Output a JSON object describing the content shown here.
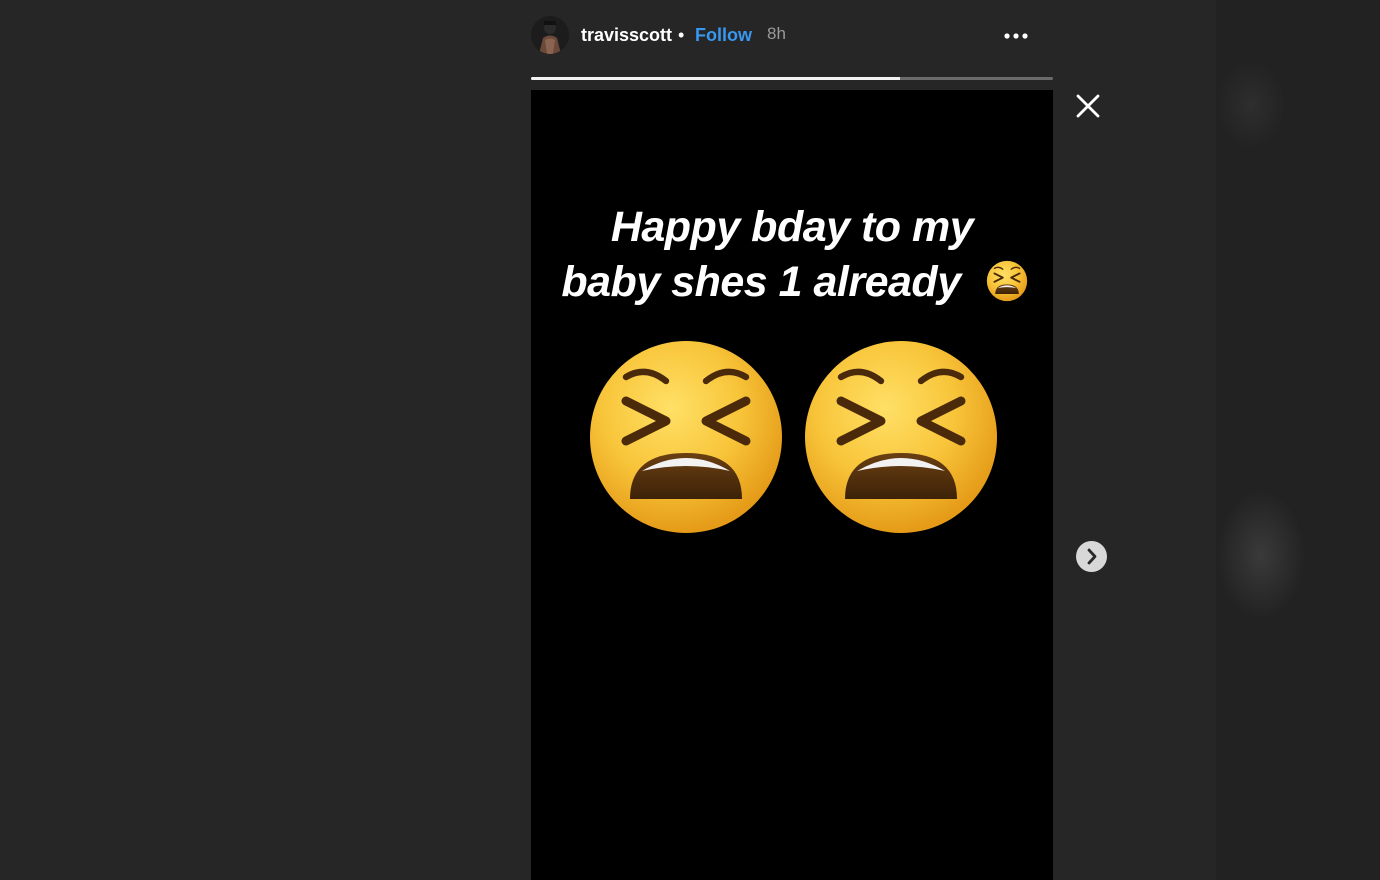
{
  "story": {
    "username": "travisscott",
    "separator": "•",
    "follow_label": "Follow",
    "time_ago": "8h",
    "progress_fraction": 0.707,
    "caption_lines": [
      "Happy bday to my",
      "baby shes 1 already"
    ]
  },
  "icons": {
    "more": "more-options-icon",
    "close": "close-icon",
    "next": "chevron-right-icon",
    "emoji": "tired-face-emoji"
  },
  "colors": {
    "background": "#262626",
    "follow": "#3897f0",
    "story_bg": "#000000"
  }
}
